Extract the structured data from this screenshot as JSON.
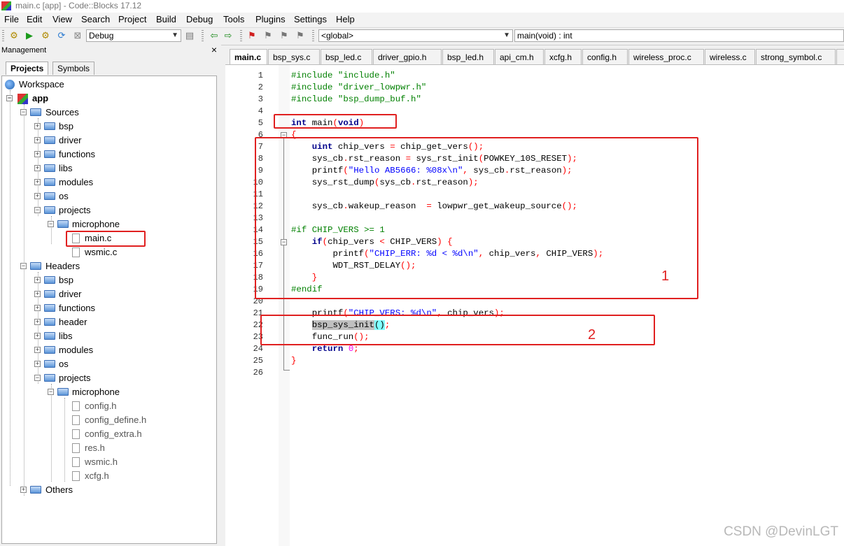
{
  "window": {
    "title": "main.c [app] - Code::Blocks 17.12"
  },
  "menu": [
    "File",
    "Edit",
    "View",
    "Search",
    "Project",
    "Build",
    "Debug",
    "Tools",
    "Plugins",
    "Settings",
    "Help"
  ],
  "toolbar": {
    "build_target": "Debug",
    "scope_combo": "<global>",
    "function_combo": "main(void) : int"
  },
  "management": {
    "title": "Management",
    "close": "×",
    "tabs": [
      "Projects",
      "Symbols"
    ],
    "tree": {
      "workspace": "Workspace",
      "project": "app",
      "sources": "Sources",
      "source_folders": [
        "bsp",
        "driver",
        "functions",
        "libs",
        "modules",
        "os"
      ],
      "source_projects": "projects",
      "source_microphone": "microphone",
      "source_files": [
        "main.c",
        "wsmic.c"
      ],
      "headers": "Headers",
      "header_folders": [
        "bsp",
        "driver",
        "functions",
        "header",
        "libs",
        "modules",
        "os"
      ],
      "header_projects": "projects",
      "header_microphone": "microphone",
      "header_files": [
        "config.h",
        "config_define.h",
        "config_extra.h",
        "res.h",
        "wsmic.h",
        "xcfg.h"
      ],
      "others": "Others"
    }
  },
  "editor": {
    "tabs": [
      "main.c",
      "bsp_sys.c",
      "bsp_led.c",
      "driver_gpio.h",
      "bsp_led.h",
      "api_cm.h",
      "xcfg.h",
      "config.h",
      "wireless_proc.c",
      "wireless.c",
      "strong_symbol.c"
    ],
    "line_numbers": [
      "1",
      "2",
      "3",
      "4",
      "5",
      "6",
      "7",
      "8",
      "9",
      "10",
      "11",
      "12",
      "13",
      "14",
      "15",
      "16",
      "17",
      "18",
      "19",
      "20",
      "21",
      "22",
      "23",
      "24",
      "25",
      "26"
    ]
  },
  "annotations": {
    "box1": "1",
    "box2": "2"
  },
  "watermark": "CSDN @DevinLGT"
}
